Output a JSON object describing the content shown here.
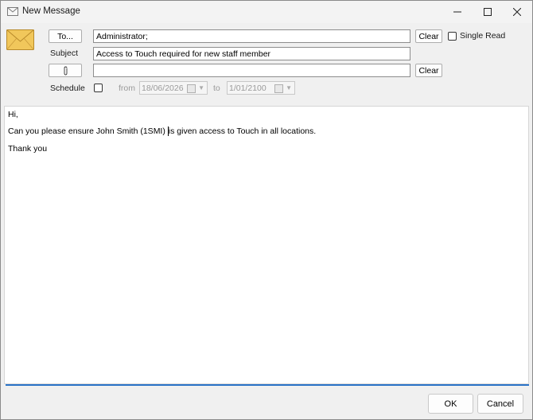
{
  "window": {
    "title": "New Message"
  },
  "header": {
    "to_button": "To...",
    "to_value": "Administrator;",
    "clear_to": "Clear",
    "single_read_label": "Single Read",
    "subject_label": "Subject",
    "subject_value": "Access to Touch required for new staff member",
    "attachment_value": "",
    "clear_attachment": "Clear",
    "schedule_label": "Schedule",
    "from_label": "from",
    "from_date": "18/06/2026",
    "to_label": "to",
    "to_date": "1/01/2100"
  },
  "body": {
    "line1": "Hi,",
    "line2_before": "Can you please ensure John Smith (1SMI) ",
    "line2_after": "is given access to Touch in all locations.",
    "line3": "Thank you"
  },
  "footer": {
    "ok": "OK",
    "cancel": "Cancel"
  },
  "colors": {
    "accent": "#2a73c7",
    "envelope": "#f1c75b"
  }
}
